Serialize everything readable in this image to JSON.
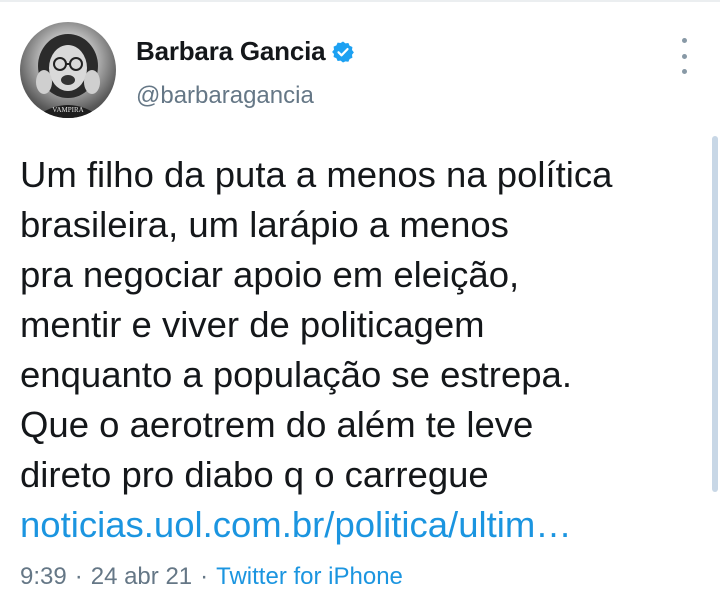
{
  "author": {
    "display_name": "Barbara Gancia",
    "handle": "@barbaragancia",
    "verified_icon": "verified-badge-icon",
    "avatar_text": "VAMPIRA"
  },
  "tweet": {
    "text": "Um filho da puta a menos na política\nbrasileira, um larápio a menos\npra negociar apoio em eleição,\nmentir e viver de politicagem\nenquanto a população se estrepa.\nQue o aerotrem do além te leve\ndireto pro diabo q o carregue",
    "link": "noticias.uol.com.br/politica/ultim…",
    "time": "9:39",
    "date": "24 abr 21",
    "separator": "·",
    "source": "Twitter for iPhone"
  },
  "colors": {
    "text": "#14171a",
    "secondary": "#657786",
    "link": "#1b95e0",
    "verified": "#1da1f2"
  },
  "icons": {
    "more": "more-options-icon"
  }
}
